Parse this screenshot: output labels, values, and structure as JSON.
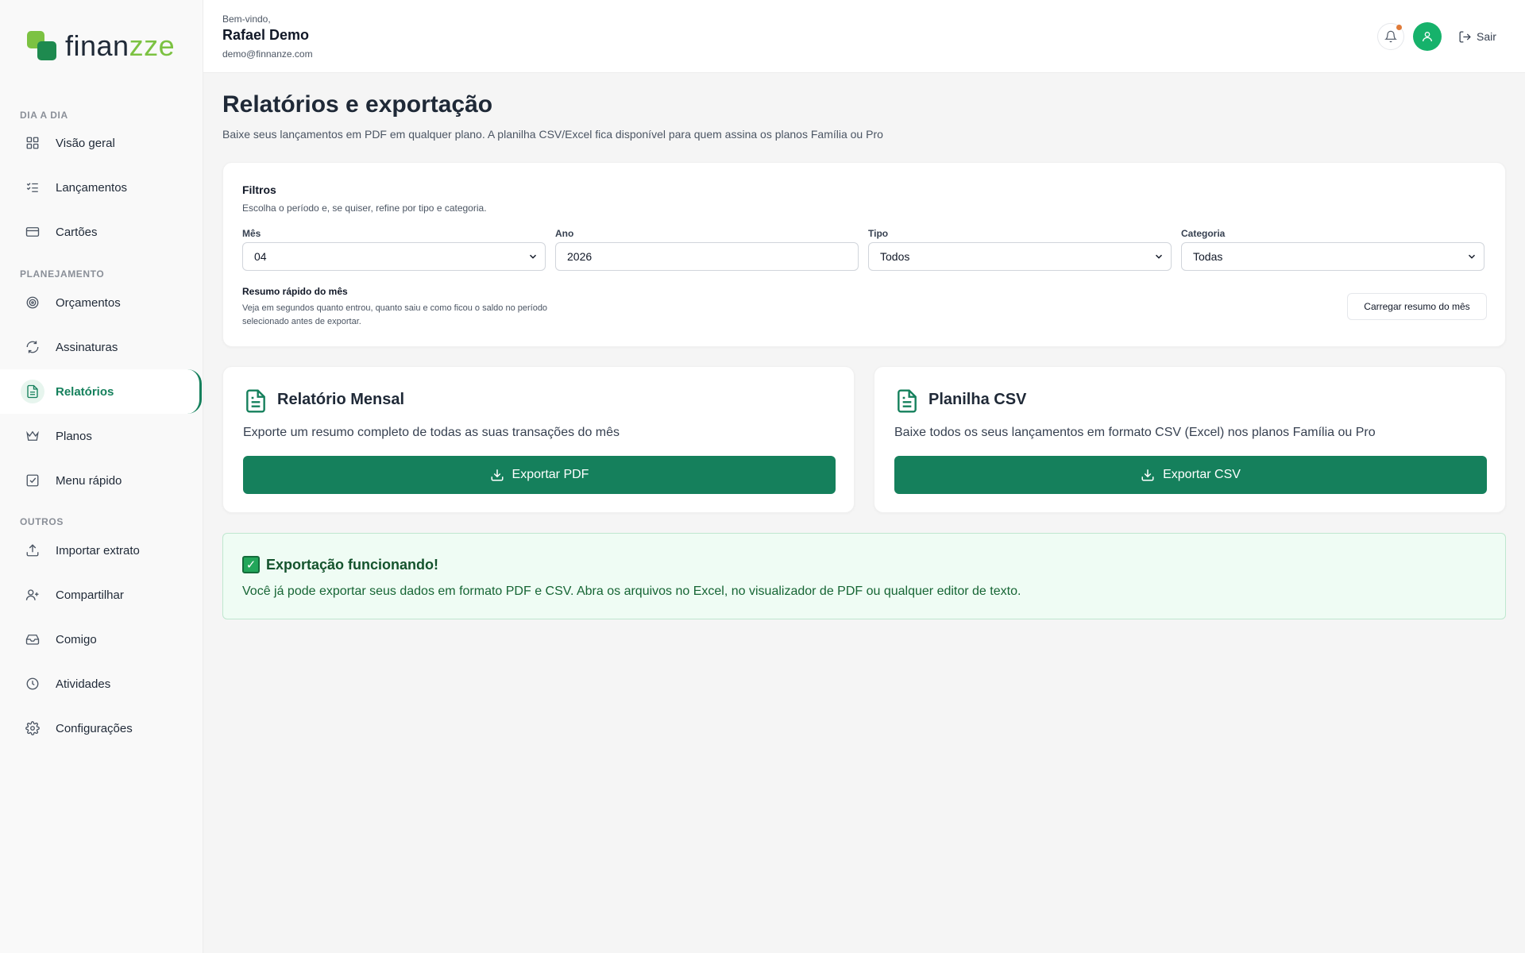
{
  "app": {
    "logo_prefix": "finan",
    "logo_accent": "zze"
  },
  "sidebar": {
    "section_daily": "DIA A DIA",
    "section_planning": "PLANEJAMENTO",
    "section_others": "OUTROS",
    "items": [
      {
        "label": "Visão geral",
        "icon": "grid-icon"
      },
      {
        "label": "Lançamentos",
        "icon": "list-check-icon"
      },
      {
        "label": "Cartões",
        "icon": "credit-card-icon"
      },
      {
        "label": "Orçamentos",
        "icon": "target-icon"
      },
      {
        "label": "Assinaturas",
        "icon": "refresh-icon"
      },
      {
        "label": "Relatórios",
        "icon": "file-text-icon"
      },
      {
        "label": "Planos",
        "icon": "crown-icon"
      },
      {
        "label": "Menu rápido",
        "icon": "check-square-icon"
      },
      {
        "label": "Importar extrato",
        "icon": "upload-icon"
      },
      {
        "label": "Compartilhar",
        "icon": "user-plus-icon"
      },
      {
        "label": "Comigo",
        "icon": "inbox-icon"
      },
      {
        "label": "Atividades",
        "icon": "clock-icon"
      },
      {
        "label": "Configurações",
        "icon": "gear-icon"
      }
    ],
    "active": "Relatórios"
  },
  "header": {
    "welcome": "Bem-vindo,",
    "user_name": "Rafael Demo",
    "user_email": "demo@finnanze.com",
    "logout_label": "Sair"
  },
  "page": {
    "title": "Relatórios e exportação",
    "subtitle": "Baixe seus lançamentos em PDF em qualquer plano. A planilha CSV/Excel fica disponível para quem assina os planos Família ou Pro"
  },
  "filters": {
    "title": "Filtros",
    "subtitle": "Escolha o período e, se quiser, refine por tipo e categoria.",
    "month_label": "Mês",
    "month_value": "04",
    "year_label": "Ano",
    "year_value": "2026",
    "type_label": "Tipo",
    "type_value": "Todos",
    "category_label": "Categoria",
    "category_value": "Todas",
    "quick_title": "Resumo rápido do mês",
    "quick_desc": "Veja em segundos quanto entrou, quanto saiu e como ficou o saldo no período selecionado antes de exportar.",
    "quick_button": "Carregar resumo do mês"
  },
  "export_pdf": {
    "title": "Relatório Mensal",
    "description": "Exporte um resumo completo de todas as suas transações do mês",
    "button": "Exportar PDF"
  },
  "export_csv": {
    "title": "Planilha CSV",
    "description": "Baixe todos os seus lançamentos em formato CSV (Excel) nos planos Família ou Pro",
    "button": "Exportar CSV"
  },
  "success": {
    "title": "Exportação funcionando!",
    "description": "Você já pode exportar seus dados em formato PDF e CSV. Abra os arquivos no Excel, no visualizador de PDF ou qualquer editor de texto."
  },
  "colors": {
    "brand_green": "#15805c",
    "logo_light_green": "#7cc242",
    "notification_dot": "#e07b39",
    "avatar": "#16b26b"
  }
}
